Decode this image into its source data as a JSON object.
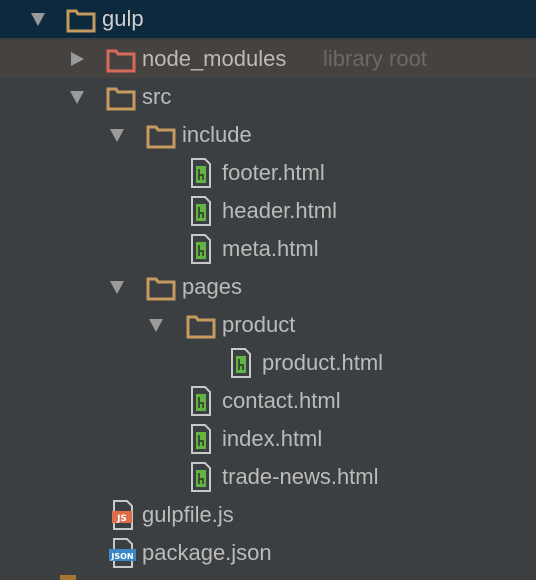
{
  "project_tree": {
    "root": {
      "label": "gulp",
      "icon": "folder-icon",
      "expanded": true
    },
    "node_modules": {
      "label": "node_modules",
      "suffix": "library root",
      "icon": "excluded-folder-icon",
      "expanded": false
    },
    "src": {
      "label": "src",
      "icon": "folder-icon",
      "expanded": true
    },
    "include": {
      "label": "include",
      "icon": "folder-icon",
      "expanded": true,
      "files": [
        "footer.html",
        "header.html",
        "meta.html"
      ]
    },
    "pages": {
      "label": "pages",
      "icon": "folder-icon",
      "expanded": true,
      "product_folder": {
        "label": "product",
        "icon": "folder-icon",
        "expanded": true,
        "files": [
          "product.html"
        ]
      },
      "files": [
        "contact.html",
        "index.html",
        "trade-news.html"
      ]
    },
    "gulpfile": {
      "label": "gulpfile.js",
      "icon": "js-file-icon",
      "badge": "JS"
    },
    "package": {
      "label": "package.json",
      "icon": "json-file-icon",
      "badge": "JSON"
    }
  },
  "colors": {
    "background": "#3c3f41",
    "selected_row": "#0d293e",
    "excluded_row": "#45423f",
    "text": "#bbbbbb",
    "muted_text": "#6a6a6a",
    "folder": "#c69b5d",
    "excluded_folder": "#d86a5a",
    "html_file_green": "#62b543",
    "js_badge": "#e06d4a",
    "json_badge": "#3a86c8"
  }
}
